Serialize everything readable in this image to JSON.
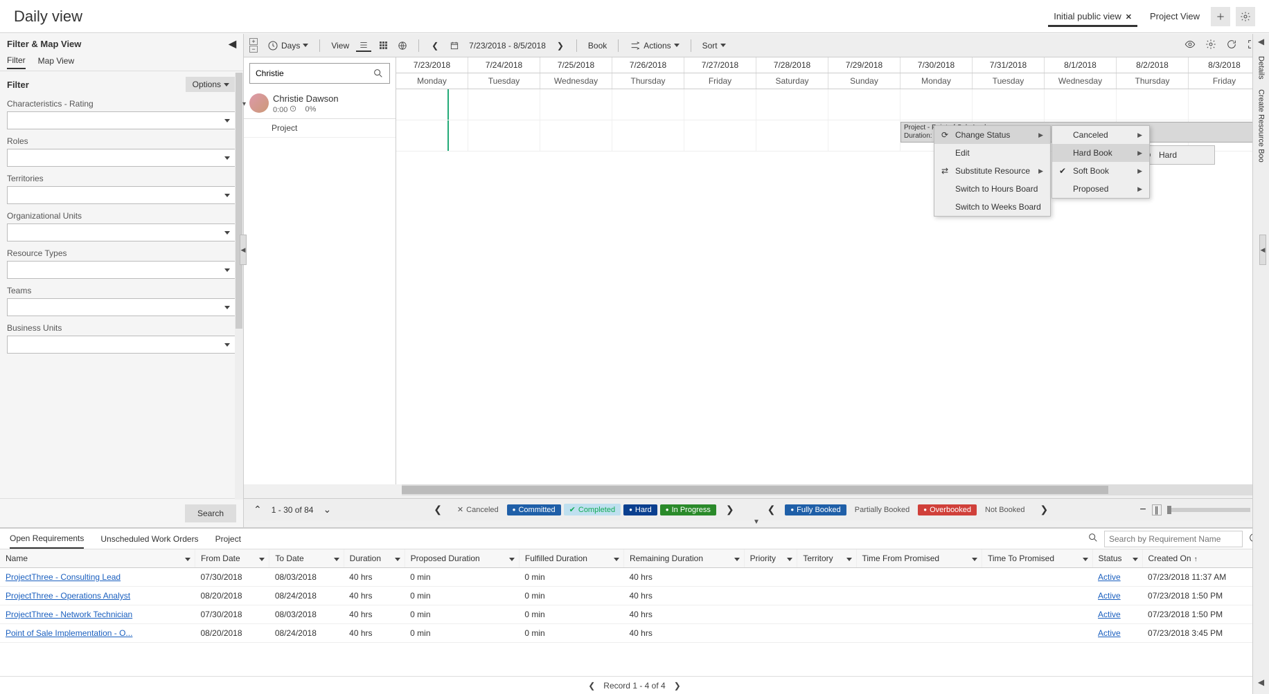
{
  "header": {
    "title": "Daily view",
    "views": [
      {
        "label": "Initial public view",
        "closable": true,
        "active": true
      },
      {
        "label": "Project View",
        "closable": false,
        "active": false
      }
    ]
  },
  "sidebar": {
    "title": "Filter & Map View",
    "tabs": [
      "Filter",
      "Map View"
    ],
    "active_tab": 0,
    "filter_title": "Filter",
    "options_label": "Options",
    "groups": [
      {
        "label": "Characteristics - Rating"
      },
      {
        "label": "Roles"
      },
      {
        "label": "Territories"
      },
      {
        "label": "Organizational Units"
      },
      {
        "label": "Resource Types"
      },
      {
        "label": "Teams"
      },
      {
        "label": "Business Units"
      }
    ],
    "search_label": "Search"
  },
  "toolbar": {
    "days_label": "Days",
    "view_label": "View",
    "date_range": "7/23/2018 - 8/5/2018",
    "book_label": "Book",
    "actions_label": "Actions",
    "sort_label": "Sort"
  },
  "resources": {
    "search_value": "Christie",
    "rows": [
      {
        "name": "Christie Dawson",
        "time": "0:00",
        "pct": "0%"
      }
    ],
    "project_row_label": "Project"
  },
  "dates": [
    {
      "date": "7/23/2018",
      "dow": "Monday"
    },
    {
      "date": "7/24/2018",
      "dow": "Tuesday"
    },
    {
      "date": "7/25/2018",
      "dow": "Wednesday"
    },
    {
      "date": "7/26/2018",
      "dow": "Thursday"
    },
    {
      "date": "7/27/2018",
      "dow": "Friday"
    },
    {
      "date": "7/28/2018",
      "dow": "Saturday"
    },
    {
      "date": "7/29/2018",
      "dow": "Sunday"
    },
    {
      "date": "7/30/2018",
      "dow": "Monday"
    },
    {
      "date": "7/31/2018",
      "dow": "Tuesday"
    },
    {
      "date": "8/1/2018",
      "dow": "Wednesday"
    },
    {
      "date": "8/2/2018",
      "dow": "Thursday"
    },
    {
      "date": "8/3/2018",
      "dow": "Friday"
    }
  ],
  "booking": {
    "line1": "Project - Point of Sale Implemen",
    "line2": "Duration:"
  },
  "context_menu": {
    "items": [
      {
        "label": "Change Status",
        "submenu": true,
        "icon": "status"
      },
      {
        "label": "Edit"
      },
      {
        "label": "Substitute Resource",
        "submenu": true,
        "icon": "sub"
      },
      {
        "label": "Switch to Hours Board"
      },
      {
        "label": "Switch to Weeks Board"
      }
    ],
    "submenu": [
      {
        "label": "Canceled",
        "submenu": true
      },
      {
        "label": "Hard Book",
        "submenu": true,
        "hover": true
      },
      {
        "label": "Soft Book",
        "submenu": true,
        "icon": "check"
      },
      {
        "label": "Proposed",
        "submenu": true
      }
    ],
    "leaf": "Hard"
  },
  "board_footer": {
    "page_text": "1 - 30 of 84",
    "legend": [
      {
        "label": "Canceled",
        "color": "",
        "plain": true,
        "x": true
      },
      {
        "label": "Committed",
        "color": "#1f5fa8"
      },
      {
        "label": "Completed",
        "color": "#bfe0ef",
        "text": "#2a5",
        "check": true
      },
      {
        "label": "Hard",
        "color": "#0a3f8f"
      },
      {
        "label": "In Progress",
        "color": "#2a8a2a"
      },
      {
        "label": "Fully Booked",
        "color": "#1f5fa8"
      },
      {
        "label": "Partially Booked",
        "color": "",
        "plain": true
      },
      {
        "label": "Overbooked",
        "color": "#d0403a"
      },
      {
        "label": "Not Booked",
        "color": "",
        "plain": true
      }
    ]
  },
  "right_rail": {
    "details": "Details",
    "create": "Create Resource Boo"
  },
  "lower": {
    "tabs": [
      "Open Requirements",
      "Unscheduled Work Orders",
      "Project"
    ],
    "active_tab": 0,
    "search_placeholder": "Search by Requirement Name",
    "columns": [
      "Name",
      "From Date",
      "To Date",
      "Duration",
      "Proposed Duration",
      "Fulfilled Duration",
      "Remaining Duration",
      "Priority",
      "Territory",
      "Time From Promised",
      "Time To Promised",
      "Status",
      "Created On"
    ],
    "rows": [
      {
        "name": "ProjectThree - Consulting Lead",
        "from": "07/30/2018",
        "to": "08/03/2018",
        "dur": "40 hrs",
        "prop": "0 min",
        "ful": "0 min",
        "rem": "40 hrs",
        "pri": "",
        "terr": "",
        "tfp": "",
        "ttp": "",
        "status": "Active",
        "created": "07/23/2018 11:37 AM"
      },
      {
        "name": "ProjectThree - Operations Analyst",
        "from": "08/20/2018",
        "to": "08/24/2018",
        "dur": "40 hrs",
        "prop": "0 min",
        "ful": "0 min",
        "rem": "40 hrs",
        "pri": "",
        "terr": "",
        "tfp": "",
        "ttp": "",
        "status": "Active",
        "created": "07/23/2018 1:50 PM"
      },
      {
        "name": "ProjectThree - Network Technician",
        "from": "07/30/2018",
        "to": "08/03/2018",
        "dur": "40 hrs",
        "prop": "0 min",
        "ful": "0 min",
        "rem": "40 hrs",
        "pri": "",
        "terr": "",
        "tfp": "",
        "ttp": "",
        "status": "Active",
        "created": "07/23/2018 1:50 PM"
      },
      {
        "name": "Point of Sale Implementation - O...",
        "from": "08/20/2018",
        "to": "08/24/2018",
        "dur": "40 hrs",
        "prop": "0 min",
        "ful": "0 min",
        "rem": "40 hrs",
        "pri": "",
        "terr": "",
        "tfp": "",
        "ttp": "",
        "status": "Active",
        "created": "07/23/2018 3:45 PM"
      }
    ],
    "pager": "Record 1 - 4 of 4"
  }
}
